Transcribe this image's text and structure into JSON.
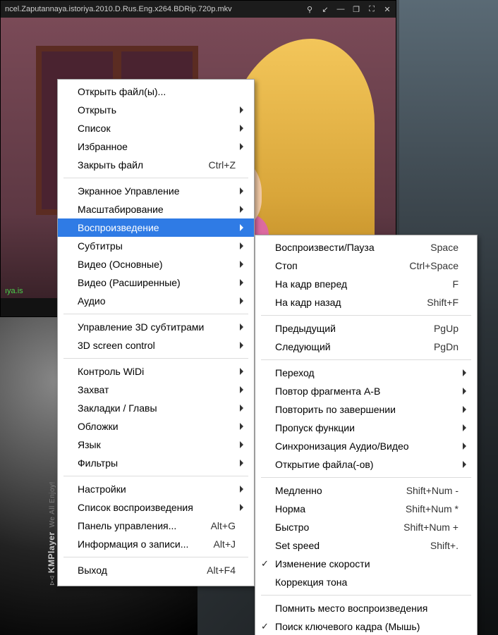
{
  "player": {
    "title": "ncel.Zaputannaya.istoriya.2010.D.Rus.Eng.x264.BDRip.720p.mkv",
    "caption": "ıya.is",
    "buttons": {
      "pin": "⚲",
      "compact": "↙",
      "min": "—",
      "restore": "❐",
      "max": "⛶",
      "close": "✕"
    }
  },
  "brand": {
    "name": "KMPlayer",
    "tagline": "We All Enjoy!"
  },
  "menu_main": [
    {
      "type": "item",
      "name": "open-files",
      "label": "Открыть файл(ы)..."
    },
    {
      "type": "item",
      "name": "open",
      "label": "Открыть",
      "submenu": true
    },
    {
      "type": "item",
      "name": "list",
      "label": "Список",
      "submenu": true
    },
    {
      "type": "item",
      "name": "favorites",
      "label": "Избранное",
      "submenu": true
    },
    {
      "type": "item",
      "name": "close-file",
      "label": "Закрыть файл",
      "shortcut": "Ctrl+Z"
    },
    {
      "type": "sep"
    },
    {
      "type": "item",
      "name": "screen-control",
      "label": "Экранное Управление",
      "submenu": true
    },
    {
      "type": "item",
      "name": "zoom",
      "label": "Масштабирование",
      "submenu": true
    },
    {
      "type": "item",
      "name": "playback",
      "label": "Воспроизведение",
      "submenu": true,
      "hover": true
    },
    {
      "type": "item",
      "name": "subtitles",
      "label": "Субтитры",
      "submenu": true
    },
    {
      "type": "item",
      "name": "video-basic",
      "label": "Видео (Основные)",
      "submenu": true
    },
    {
      "type": "item",
      "name": "video-advanced",
      "label": "Видео (Расширенные)",
      "submenu": true
    },
    {
      "type": "item",
      "name": "audio",
      "label": "Аудио",
      "submenu": true
    },
    {
      "type": "sep"
    },
    {
      "type": "item",
      "name": "3d-subtitles",
      "label": "Управление 3D субтитрами",
      "submenu": true
    },
    {
      "type": "item",
      "name": "3d-screen-control",
      "label": "3D screen control",
      "submenu": true
    },
    {
      "type": "sep"
    },
    {
      "type": "item",
      "name": "widi-control",
      "label": "Контроль WiDi",
      "submenu": true
    },
    {
      "type": "item",
      "name": "capture",
      "label": "Захват",
      "submenu": true
    },
    {
      "type": "item",
      "name": "bookmarks-chapters",
      "label": "Закладки / Главы",
      "submenu": true
    },
    {
      "type": "item",
      "name": "covers",
      "label": "Обложки",
      "submenu": true
    },
    {
      "type": "item",
      "name": "language",
      "label": "Язык",
      "submenu": true
    },
    {
      "type": "item",
      "name": "filters",
      "label": "Фильтры",
      "submenu": true
    },
    {
      "type": "sep"
    },
    {
      "type": "item",
      "name": "settings",
      "label": "Настройки",
      "submenu": true
    },
    {
      "type": "item",
      "name": "playlist",
      "label": "Список воспроизведения",
      "submenu": true
    },
    {
      "type": "item",
      "name": "control-panel",
      "label": "Панель управления...",
      "shortcut": "Alt+G"
    },
    {
      "type": "item",
      "name": "record-info",
      "label": "Информация о записи...",
      "shortcut": "Alt+J"
    },
    {
      "type": "sep"
    },
    {
      "type": "item",
      "name": "exit",
      "label": "Выход",
      "shortcut": "Alt+F4"
    }
  ],
  "menu_sub": [
    {
      "type": "item",
      "name": "play-pause",
      "label": "Воспроизвести/Пауза",
      "shortcut": "Space"
    },
    {
      "type": "item",
      "name": "stop",
      "label": "Стоп",
      "shortcut": "Ctrl+Space"
    },
    {
      "type": "item",
      "name": "frame-forward",
      "label": "На кадр вперед",
      "shortcut": "F"
    },
    {
      "type": "item",
      "name": "frame-back",
      "label": "На кадр назад",
      "shortcut": "Shift+F"
    },
    {
      "type": "sep"
    },
    {
      "type": "item",
      "name": "previous",
      "label": "Предыдущий",
      "shortcut": "PgUp"
    },
    {
      "type": "item",
      "name": "next",
      "label": "Следующий",
      "shortcut": "PgDn"
    },
    {
      "type": "sep"
    },
    {
      "type": "item",
      "name": "jump",
      "label": "Переход",
      "submenu": true
    },
    {
      "type": "item",
      "name": "ab-repeat",
      "label": "Повтор фрагмента A-B",
      "submenu": true
    },
    {
      "type": "item",
      "name": "repeat-on-end",
      "label": "Повторить по завершении",
      "submenu": true
    },
    {
      "type": "item",
      "name": "skip-function",
      "label": "Пропуск функции",
      "submenu": true
    },
    {
      "type": "item",
      "name": "av-sync",
      "label": "Синхронизация Аудио/Видео",
      "submenu": true
    },
    {
      "type": "item",
      "name": "file-opening",
      "label": "Открытие файла(-ов)",
      "submenu": true
    },
    {
      "type": "sep"
    },
    {
      "type": "item",
      "name": "slow",
      "label": "Медленно",
      "shortcut": "Shift+Num -"
    },
    {
      "type": "item",
      "name": "normal",
      "label": "Норма",
      "shortcut": "Shift+Num *"
    },
    {
      "type": "item",
      "name": "fast",
      "label": "Быстро",
      "shortcut": "Shift+Num +"
    },
    {
      "type": "item",
      "name": "set-speed",
      "label": "Set speed",
      "shortcut": "Shift+."
    },
    {
      "type": "item",
      "name": "speed-change",
      "label": "Изменение скорости",
      "checked": true
    },
    {
      "type": "item",
      "name": "tone-correction",
      "label": "Коррекция тона"
    },
    {
      "type": "sep"
    },
    {
      "type": "item",
      "name": "remember-position",
      "label": "Помнить место воспроизведения"
    },
    {
      "type": "item",
      "name": "keyframe-seek",
      "label": "Поиск ключевого кадра (Мышь)",
      "checked": true
    }
  ]
}
